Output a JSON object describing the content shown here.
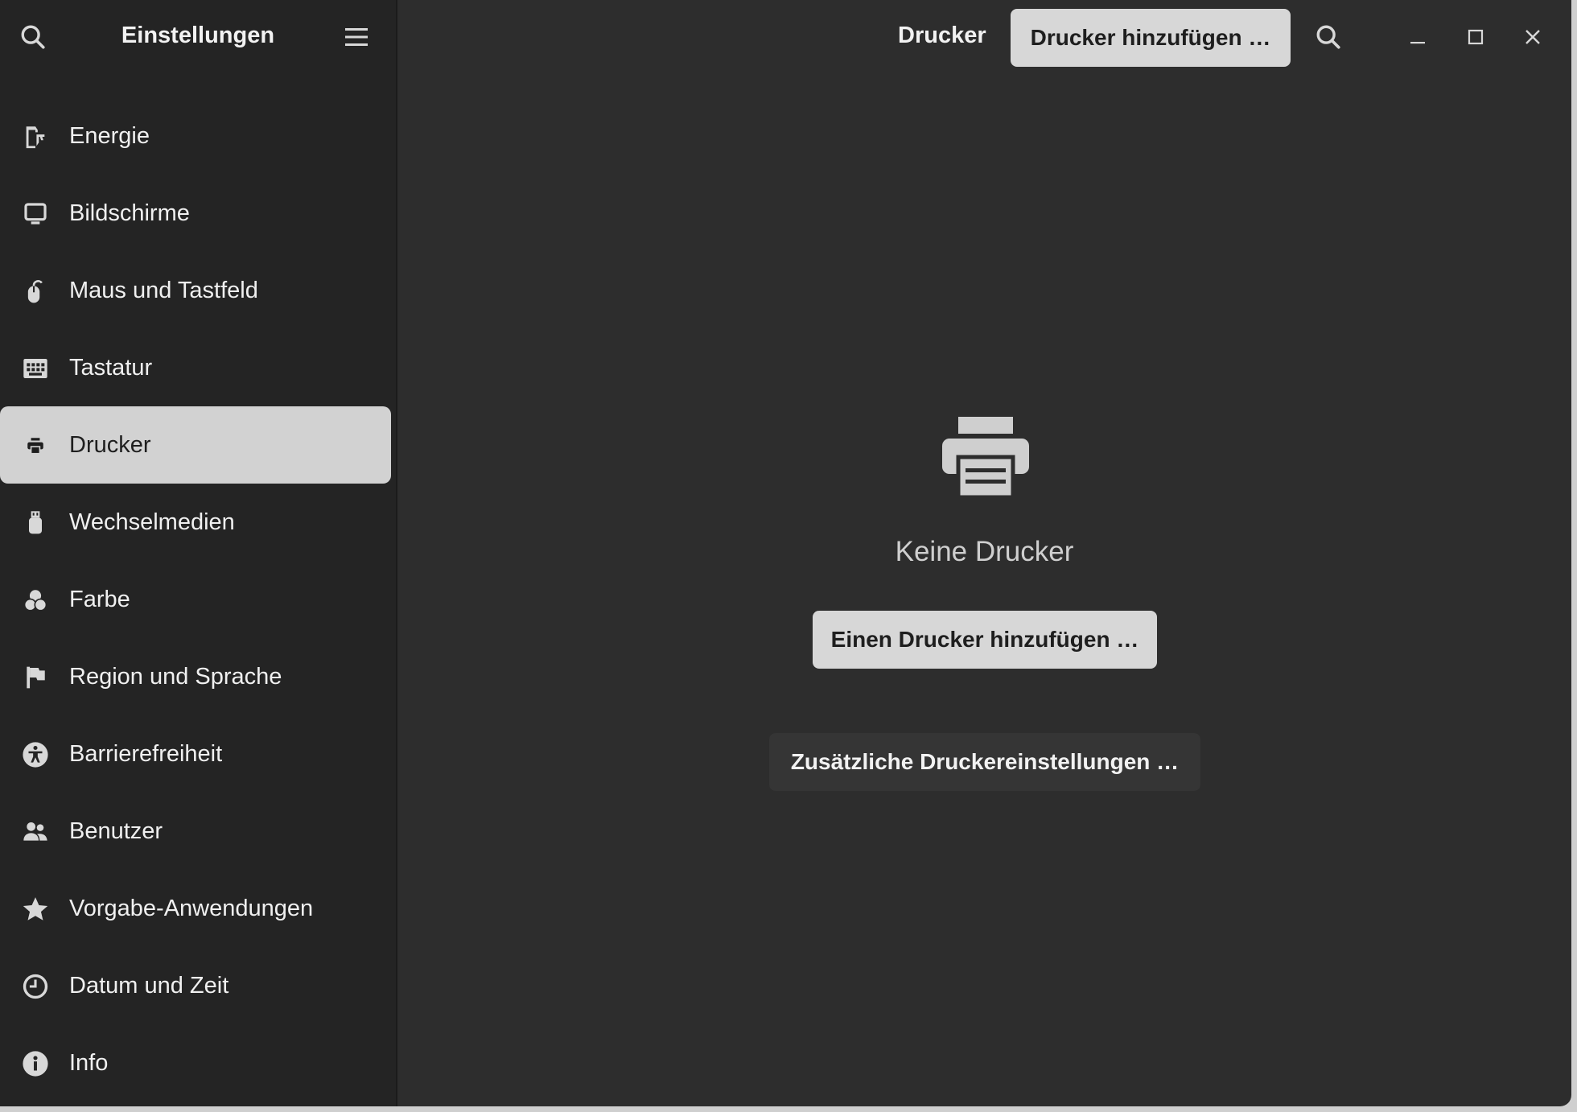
{
  "sidebar": {
    "title": "Einstellungen",
    "items": [
      {
        "label": "Energie",
        "icon": "power-icon"
      },
      {
        "label": "Bildschirme",
        "icon": "monitor-icon"
      },
      {
        "label": "Maus und Tastfeld",
        "icon": "mouse-icon"
      },
      {
        "label": "Tastatur",
        "icon": "keyboard-icon"
      },
      {
        "label": "Drucker",
        "icon": "printer-icon",
        "active": true
      },
      {
        "label": "Wechselmedien",
        "icon": "usb-icon"
      },
      {
        "label": "Farbe",
        "icon": "color-icon"
      },
      {
        "label": "Region und Sprache",
        "icon": "flag-icon"
      },
      {
        "label": "Barrierefreiheit",
        "icon": "accessibility-icon"
      },
      {
        "label": "Benutzer",
        "icon": "users-icon"
      },
      {
        "label": "Vorgabe-Anwendungen",
        "icon": "star-icon"
      },
      {
        "label": "Datum und Zeit",
        "icon": "clock-icon"
      },
      {
        "label": "Info",
        "icon": "info-icon"
      }
    ]
  },
  "header": {
    "title": "Drucker",
    "add_printer_label": "Drucker hinzufügen …"
  },
  "main": {
    "empty_label": "Keine Drucker",
    "add_button_label": "Einen Drucker hinzufügen …",
    "extra_settings_label": "Zusätzliche Druckereinstellungen …"
  },
  "colors": {
    "sidebar_bg": "#242424",
    "main_bg": "#2d2d2d",
    "active_item_bg": "#d2d2d2",
    "icon_color": "#d8d8d8"
  }
}
